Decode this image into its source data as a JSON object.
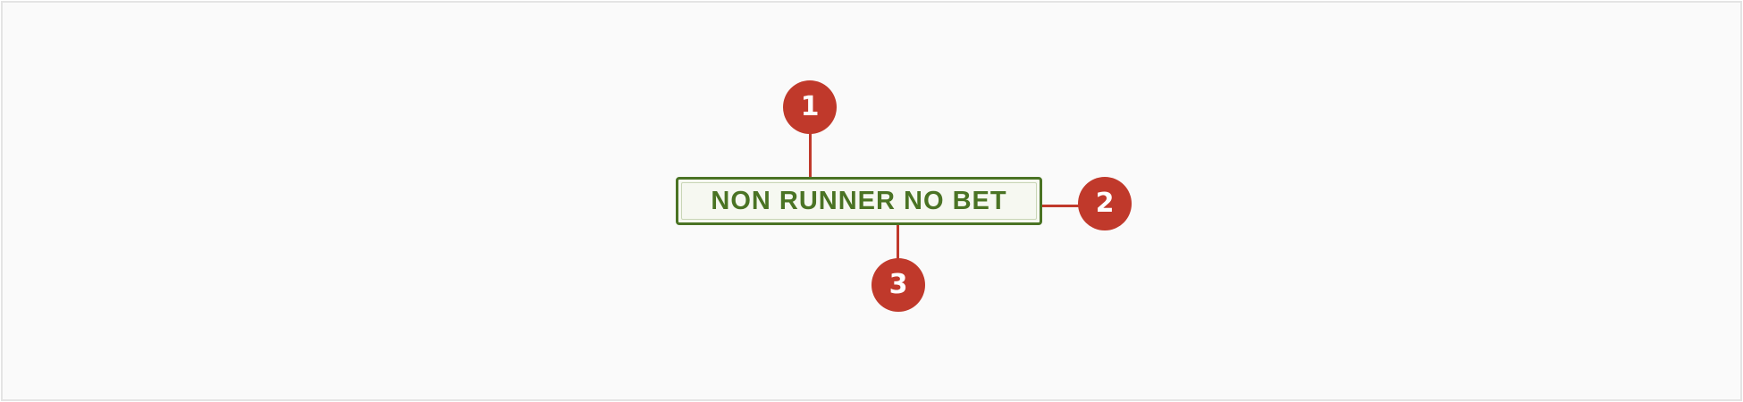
{
  "stamp": {
    "text": "NON RUNNER NO BET"
  },
  "callouts": [
    {
      "number": "1"
    },
    {
      "number": "2"
    },
    {
      "number": "3"
    }
  ],
  "colors": {
    "badge_green": "#4a7324",
    "callout_red": "#c0392b",
    "background": "#fafafa"
  }
}
